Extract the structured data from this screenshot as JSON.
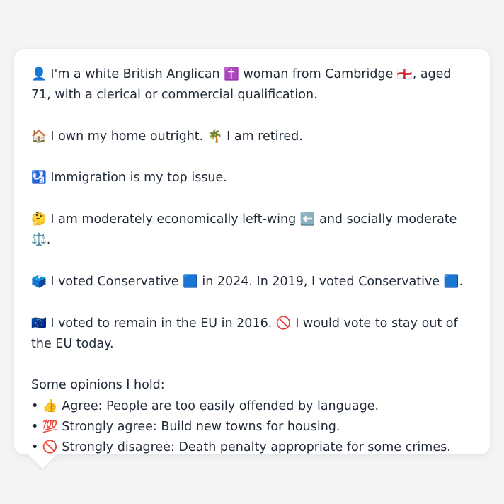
{
  "persona": {
    "intro": "👤 I'm a white British Anglican ✝️ woman from Cambridge 🏴󠁧󠁢󠁥󠁮󠁧󠁿, aged 71, with a clerical or commercial qualification.",
    "home": "🏠 I own my home outright. 🌴 I am retired.",
    "issue": "🛂 Immigration is my top issue.",
    "ideology": "🤔 I am moderately economically left-wing ⬅️ and socially moderate ⚖️.",
    "votes": "🗳️ I voted Conservative 🟦 in 2024. In 2019, I voted Conservative 🟦.",
    "eu": "🇪🇺 I voted to remain in the EU in 2016. 🚫 I would vote to stay out of the EU today.",
    "opinions_heading": "Some opinions I hold:",
    "opinions": [
      "• 👍 Agree: People are too easily offended by language.",
      "• 💯 Strongly agree: Build new towns for housing.",
      "• 🚫 Strongly disagree: Death penalty appropriate for some crimes."
    ]
  }
}
